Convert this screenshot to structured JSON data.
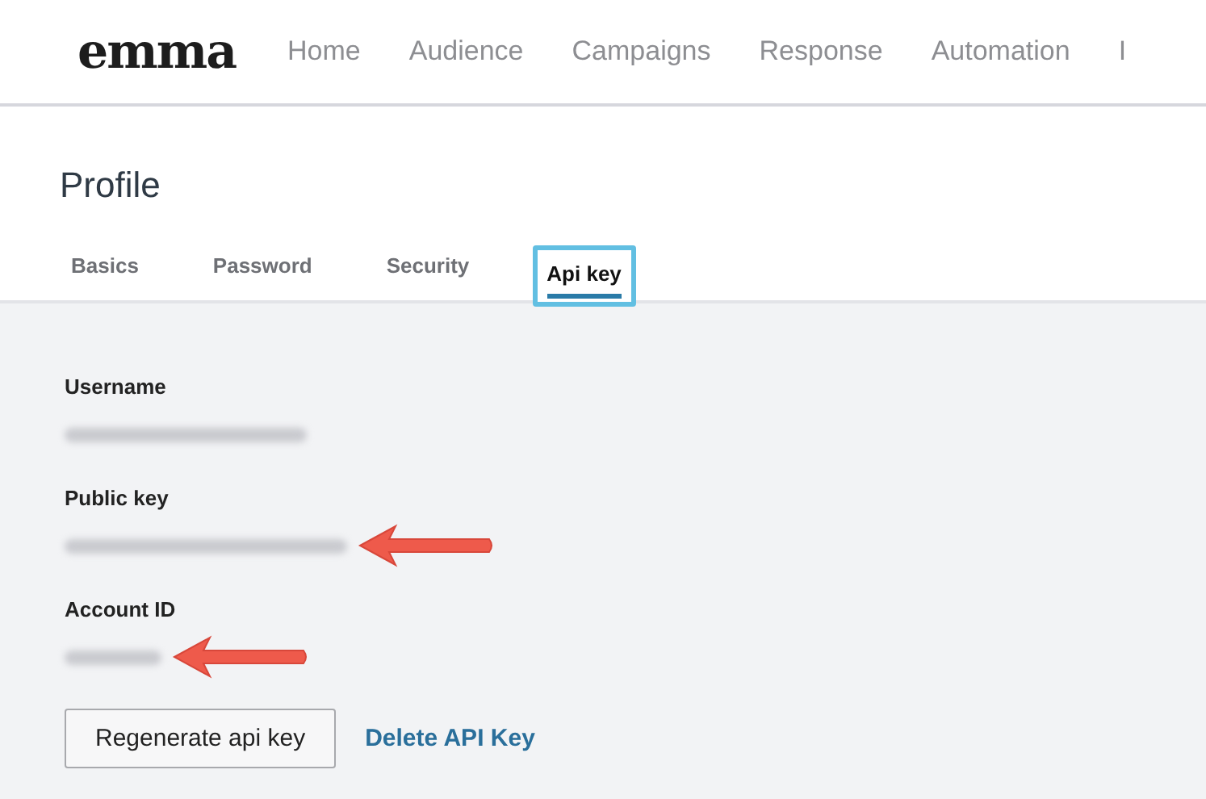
{
  "header": {
    "logo": "emma",
    "nav": [
      {
        "label": "Home"
      },
      {
        "label": "Audience"
      },
      {
        "label": "Campaigns"
      },
      {
        "label": "Response"
      },
      {
        "label": "Automation"
      },
      {
        "label": "I"
      }
    ]
  },
  "page": {
    "title": "Profile"
  },
  "tabs": [
    {
      "label": "Basics",
      "selected": false,
      "highlighted": false
    },
    {
      "label": "Password",
      "selected": false,
      "highlighted": false
    },
    {
      "label": "Security",
      "selected": false,
      "highlighted": false
    },
    {
      "label": "Api key",
      "selected": true,
      "highlighted": true
    }
  ],
  "fields": [
    {
      "label": "Username",
      "arrow": false
    },
    {
      "label": "Public key",
      "arrow": true
    },
    {
      "label": "Account ID",
      "arrow": true
    }
  ],
  "actions": {
    "button": "Regenerate api key",
    "link": "Delete API Key"
  }
}
